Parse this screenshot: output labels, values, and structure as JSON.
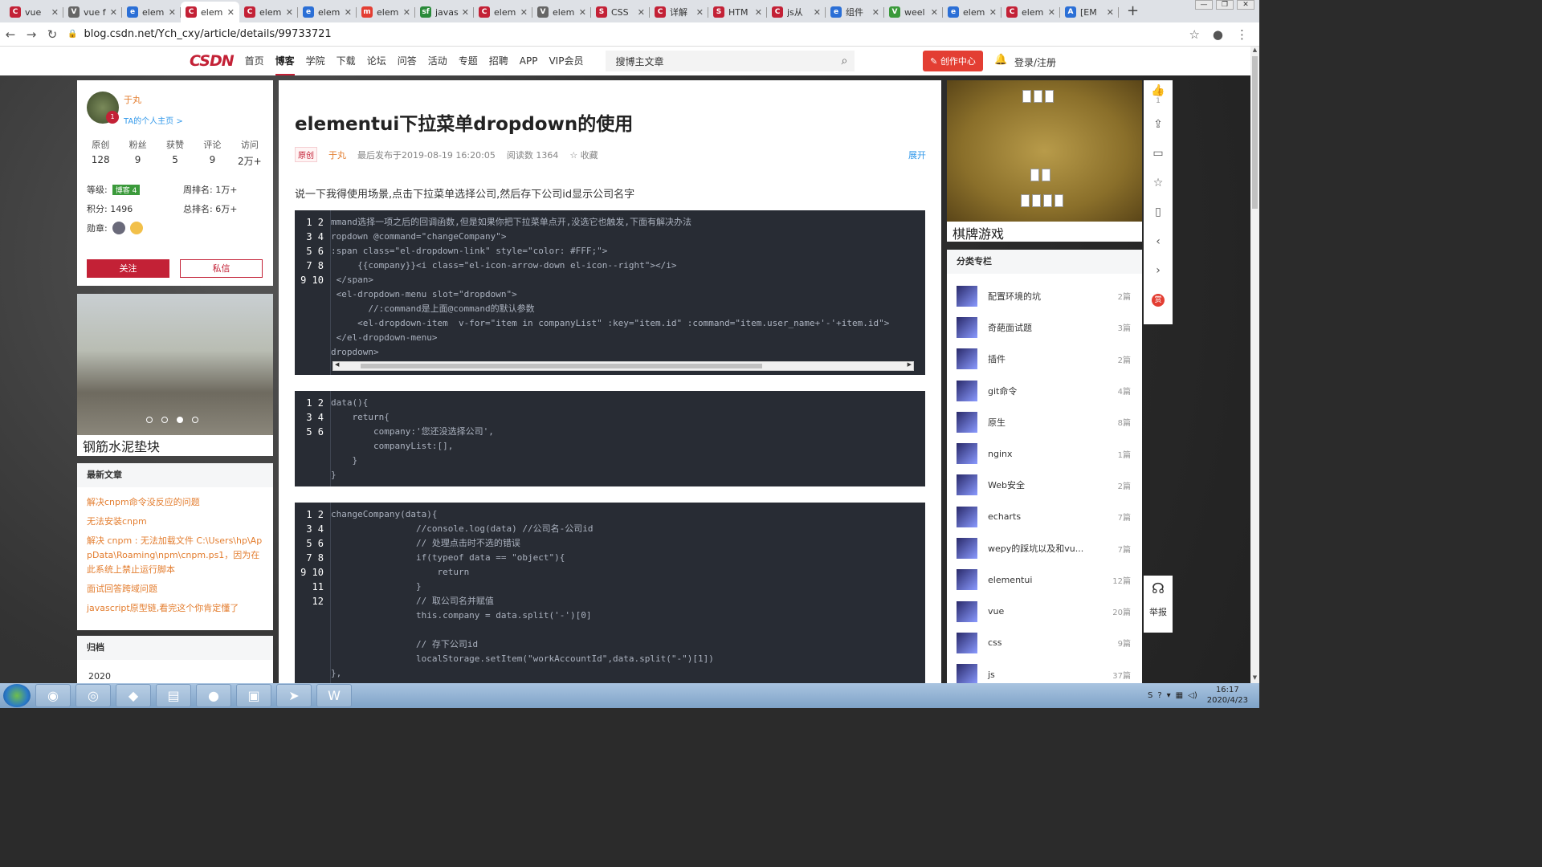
{
  "browser": {
    "tabs": [
      {
        "label": "vue",
        "color": "#c32136",
        "icon": "C"
      },
      {
        "label": "vue f",
        "color": "#666",
        "icon": "V"
      },
      {
        "label": "elem",
        "color": "#2b6fd6",
        "icon": "e"
      },
      {
        "label": "elem",
        "color": "#c32136",
        "icon": "C",
        "active": true
      },
      {
        "label": "elem",
        "color": "#c32136",
        "icon": "C"
      },
      {
        "label": "elem",
        "color": "#2b6fd6",
        "icon": "e"
      },
      {
        "label": "elem",
        "color": "#e33e33",
        "icon": "m"
      },
      {
        "label": "javas",
        "color": "#2a8a3a",
        "icon": "sf"
      },
      {
        "label": "elem",
        "color": "#c32136",
        "icon": "C"
      },
      {
        "label": "elem",
        "color": "#666",
        "icon": "V"
      },
      {
        "label": "CSS",
        "color": "#c32136",
        "icon": "S"
      },
      {
        "label": "详解",
        "color": "#c32136",
        "icon": "C"
      },
      {
        "label": "HTM",
        "color": "#c32136",
        "icon": "S"
      },
      {
        "label": "js从",
        "color": "#c32136",
        "icon": "C"
      },
      {
        "label": "组件",
        "color": "#2b6fd6",
        "icon": "e"
      },
      {
        "label": "weel",
        "color": "#3a9a3a",
        "icon": "V"
      },
      {
        "label": "elem",
        "color": "#2b6fd6",
        "icon": "e"
      },
      {
        "label": "elem",
        "color": "#c32136",
        "icon": "C"
      },
      {
        "label": "[EM",
        "color": "#2b6fd6",
        "icon": "A"
      }
    ],
    "url": "blog.csdn.net/Ych_cxy/article/details/99733721"
  },
  "header": {
    "logo": "CSDN",
    "menu": [
      "首页",
      "博客",
      "学院",
      "下载",
      "论坛",
      "问答",
      "活动",
      "专题",
      "招聘",
      "APP",
      "VIP会员"
    ],
    "active_menu": "博客",
    "search_placeholder": "搜博主文章",
    "create_label": "创作中心",
    "login_label": "登录/注册"
  },
  "profile": {
    "name": "于丸",
    "home_link": "TA的个人主页 >",
    "avatar_badge": "1",
    "stats": [
      {
        "label": "原创",
        "value": "128"
      },
      {
        "label": "粉丝",
        "value": "9"
      },
      {
        "label": "获赞",
        "value": "5"
      },
      {
        "label": "评论",
        "value": "9"
      },
      {
        "label": "访问",
        "value": "2万+"
      }
    ],
    "level_label": "等级:",
    "level_badge": "博客 4",
    "week_rank_label": "周排名:",
    "week_rank": "1万+",
    "points_label": "积分:",
    "points": "1496",
    "total_rank_label": "总排名:",
    "total_rank": "6万+",
    "medal_label": "勋章:",
    "follow_label": "关注",
    "message_label": "私信"
  },
  "ad_left": {
    "title": "钢筋水泥垫块"
  },
  "latest": {
    "heading": "最新文章",
    "items": [
      "解决cnpm命令没反应的问题",
      "无法安装cnpm",
      "解决 cnpm : 无法加载文件 C:\\Users\\hp\\AppData\\Roaming\\npm\\cnpm.ps1，因为在此系统上禁止运行脚本",
      "面试回答跨域问题",
      "javascript原型链,看完这个你肯定懂了"
    ]
  },
  "archive": {
    "heading": "归档",
    "year": "2020"
  },
  "article": {
    "title": "elementui下拉菜单dropdown的使用",
    "tag": "原创",
    "author": "于丸",
    "published": "最后发布于2019-08-19 16:20:05",
    "reads": "阅读数 1364",
    "fav": "☆ 收藏",
    "expand": "展开",
    "lead": "说一下我得使用场景,点击下拉菜单选择公司,然后存下公司id显示公司名字",
    "code1": {
      "lines": "1\n2\n3\n4\n5\n6\n7\n8\n9\n10",
      "text": "mmand选择一项之后的回调函数,但是如果你把下拉菜单点开,没选它也触发,下面有解决办法\nropdown @command=\"changeCompany\">\n:span class=\"el-dropdown-link\" style=\"color: #FFF;\">\n     {{company}}<i class=\"el-icon-arrow-down el-icon--right\"></i>\n </span>\n <el-dropdown-menu slot=\"dropdown\">\n       //:command是上面@command的默认参数\n     <el-dropdown-item  v-for=\"item in companyList\" :key=\"item.id\" :command=\"item.user_name+'-'+item.id\">\n </el-dropdown-menu>\ndropdown>"
    },
    "code2": {
      "lines": "1\n2\n3\n4\n5\n6",
      "text": "data(){\n    return{\n        company:'您还没选择公司',\n        companyList:[],\n    }\n}"
    },
    "code3": {
      "lines": "1\n2\n3\n4\n5\n6\n7\n8\n9\n10\n11\n12",
      "text": "changeCompany(data){\n                //console.log(data) //公司名-公司id\n                // 处理点击时不选的错误\n                if(typeof data == \"object\"){\n                    return\n                }\n                // 取公司名并赋值\n                this.company = data.split('-')[0]\n\n                // 存下公司id\n                localStorage.setItem(\"workAccountId\",data.split(\"-\")[1])\n},"
    }
  },
  "ad_right": {
    "title": "棋牌游戏"
  },
  "categories": {
    "heading": "分类专栏",
    "items": [
      {
        "name": "配置环境的坑",
        "count": "2篇"
      },
      {
        "name": "奇葩面试题",
        "count": "3篇"
      },
      {
        "name": "插件",
        "count": "2篇"
      },
      {
        "name": "git命令",
        "count": "4篇"
      },
      {
        "name": "原生",
        "count": "8篇"
      },
      {
        "name": "nginx",
        "count": "1篇"
      },
      {
        "name": "Web安全",
        "count": "2篇"
      },
      {
        "name": "echarts",
        "count": "7篇"
      },
      {
        "name": "wepy的踩坑以及和vu...",
        "count": "7篇"
      },
      {
        "name": "elementui",
        "count": "12篇"
      },
      {
        "name": "vue",
        "count": "20篇"
      },
      {
        "name": "css",
        "count": "9篇"
      },
      {
        "name": "js",
        "count": "37篇"
      }
    ]
  },
  "tools": {
    "like_count": "1",
    "reward": "赏",
    "report": "举报"
  },
  "taskbar": {
    "time": "16:17",
    "date": "2020/4/23"
  }
}
